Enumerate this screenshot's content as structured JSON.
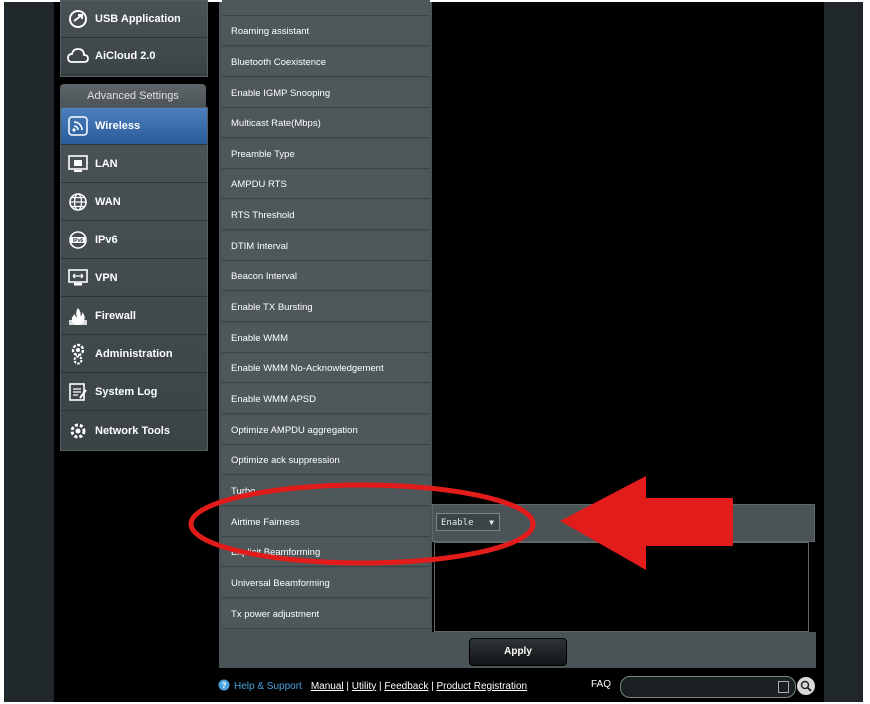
{
  "sidebar": {
    "top_items": [
      {
        "label": "USB Application",
        "icon": "usb-icon"
      },
      {
        "label": "AiCloud 2.0",
        "icon": "cloud-icon"
      }
    ],
    "advanced_header": "Advanced Settings",
    "items": [
      {
        "label": "Wireless",
        "icon": "wifi-icon",
        "active": true
      },
      {
        "label": "LAN",
        "icon": "lan-icon"
      },
      {
        "label": "WAN",
        "icon": "globe-icon"
      },
      {
        "label": "IPv6",
        "icon": "ipv6-icon"
      },
      {
        "label": "VPN",
        "icon": "vpn-icon"
      },
      {
        "label": "Firewall",
        "icon": "firewall-icon"
      },
      {
        "label": "Administration",
        "icon": "admin-icon"
      },
      {
        "label": "System Log",
        "icon": "log-icon"
      },
      {
        "label": "Network Tools",
        "icon": "tools-icon"
      }
    ]
  },
  "settings": {
    "rows": [
      "Roaming assistant",
      "Bluetooth Coexistence",
      "Enable IGMP Snooping",
      "Multicast Rate(Mbps)",
      "Preamble Type",
      "AMPDU RTS",
      "RTS Threshold",
      "DTIM Interval",
      "Beacon Interval",
      "Enable TX Bursting",
      "Enable WMM",
      "Enable WMM No-Acknowledgement",
      "Enable WMM APSD",
      "Optimize AMPDU aggregation",
      "Optimize ack suppression",
      "Turbo",
      "Airtime Fairness",
      "Explicit Beamforming",
      "Universal Beamforming",
      "Tx power adjustment"
    ],
    "airtime_fairness_value": "Enable"
  },
  "apply_label": "Apply",
  "footer": {
    "help": "Help & Support",
    "links": [
      "Manual",
      "Utility",
      "Feedback",
      "Product Registration"
    ],
    "faq": "FAQ"
  },
  "colors": {
    "highlight_red": "#e21b1b",
    "active_blue": "#3a6cae"
  }
}
